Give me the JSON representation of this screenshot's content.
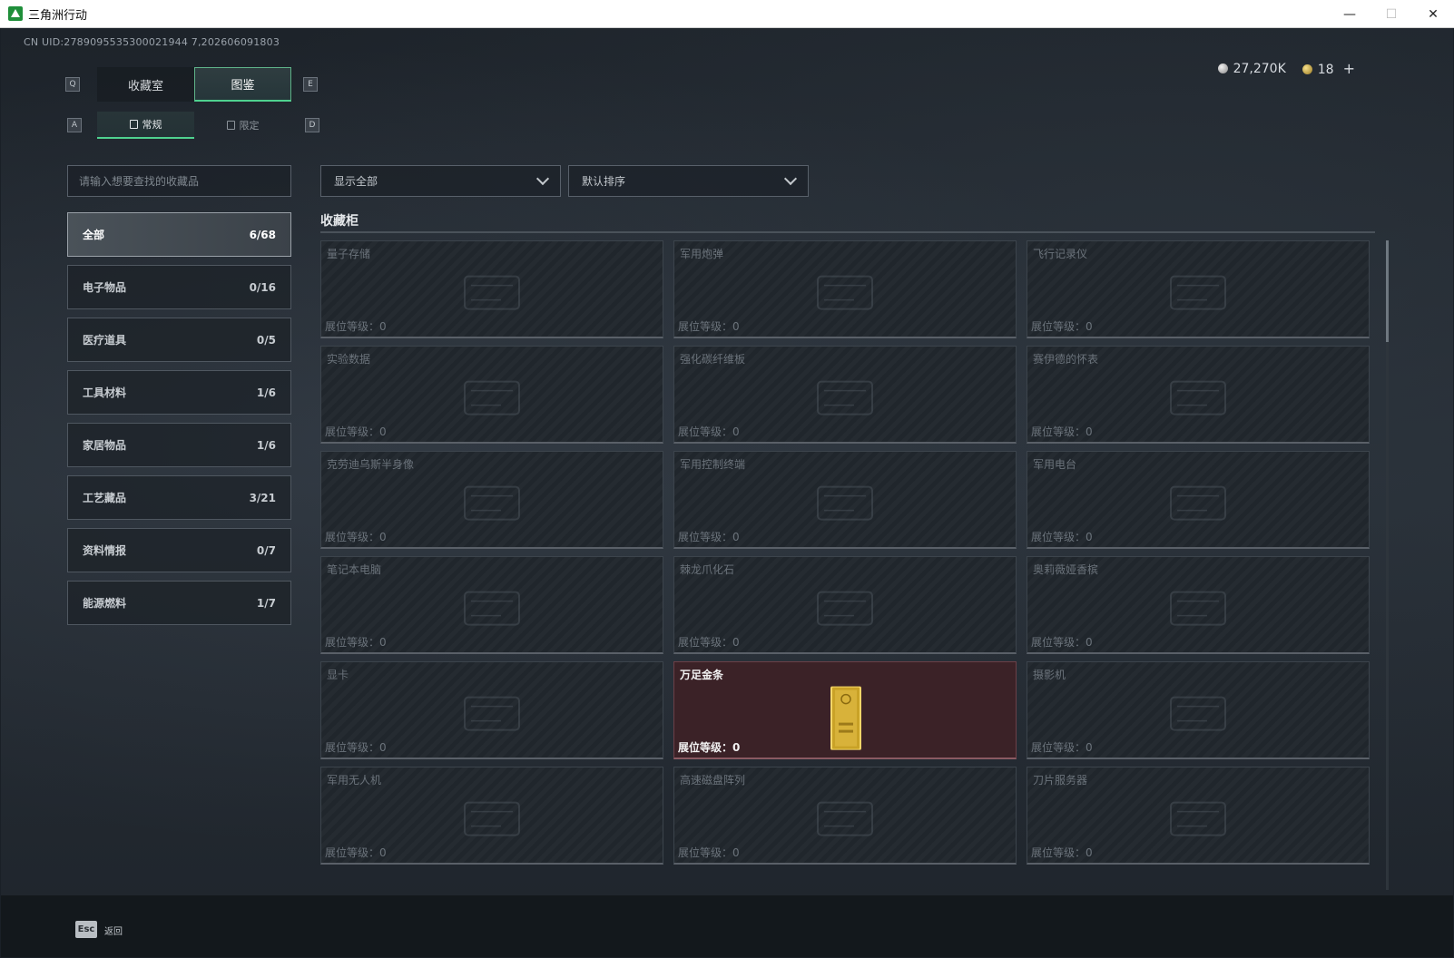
{
  "window": {
    "title": "三角洲行动",
    "minimize": "—",
    "maximize": "☐",
    "close": "✕"
  },
  "uid": "CN UID:2789095535300021944 7,202606091803",
  "currency": {
    "silver": "27,270K",
    "gold": "18",
    "add": "+"
  },
  "keys": {
    "q": "Q",
    "e": "E",
    "a": "A",
    "d": "D"
  },
  "tabs_main": [
    {
      "label": "收藏室"
    },
    {
      "label": "图鉴"
    }
  ],
  "tabs_sub": [
    {
      "label": "常规"
    },
    {
      "label": "限定"
    }
  ],
  "search": {
    "placeholder": "请输入想要查找的收藏品"
  },
  "filters": {
    "show": "显示全部",
    "sort": "默认排序"
  },
  "categories": [
    {
      "label": "全部",
      "count": "6/68"
    },
    {
      "label": "电子物品",
      "count": "0/16"
    },
    {
      "label": "医疗道具",
      "count": "0/5"
    },
    {
      "label": "工具材料",
      "count": "1/6"
    },
    {
      "label": "家居物品",
      "count": "1/6"
    },
    {
      "label": "工艺藏品",
      "count": "3/21"
    },
    {
      "label": "资料情报",
      "count": "0/7"
    },
    {
      "label": "能源燃料",
      "count": "1/7"
    }
  ],
  "section": {
    "title": "收藏柜"
  },
  "level_label": "展位等级：0",
  "items": [
    {
      "name": "量子存储",
      "icon": "usb-drive-icon"
    },
    {
      "name": "军用炮弹",
      "icon": "shell-icon"
    },
    {
      "name": "飞行记录仪",
      "icon": "flight-recorder-icon"
    },
    {
      "name": "实验数据",
      "icon": "disc-icon"
    },
    {
      "name": "强化碳纤维板",
      "icon": "plate-icon"
    },
    {
      "name": "赛伊德的怀表",
      "icon": "pocket-watch-icon"
    },
    {
      "name": "克劳迪乌斯半身像",
      "icon": "bust-icon"
    },
    {
      "name": "军用控制终端",
      "icon": "terminal-icon"
    },
    {
      "name": "军用电台",
      "icon": "radio-icon"
    },
    {
      "name": "笔记本电脑",
      "icon": "laptop-icon"
    },
    {
      "name": "棘龙爪化石",
      "icon": "fossil-icon"
    },
    {
      "name": "奥莉薇娅香槟",
      "icon": "bottle-icon"
    },
    {
      "name": "显卡",
      "icon": "gpu-icon"
    },
    {
      "name": "万足金条",
      "icon": "gold-bar-icon",
      "active": true
    },
    {
      "name": "摄影机",
      "icon": "camera-icon"
    },
    {
      "name": "军用无人机",
      "icon": "drone-icon"
    },
    {
      "name": "高速磁盘阵列",
      "icon": "disk-array-icon"
    },
    {
      "name": "刀片服务器",
      "icon": "server-icon"
    }
  ],
  "footer": {
    "esc_key": "Esc",
    "esc_label": "返回"
  }
}
